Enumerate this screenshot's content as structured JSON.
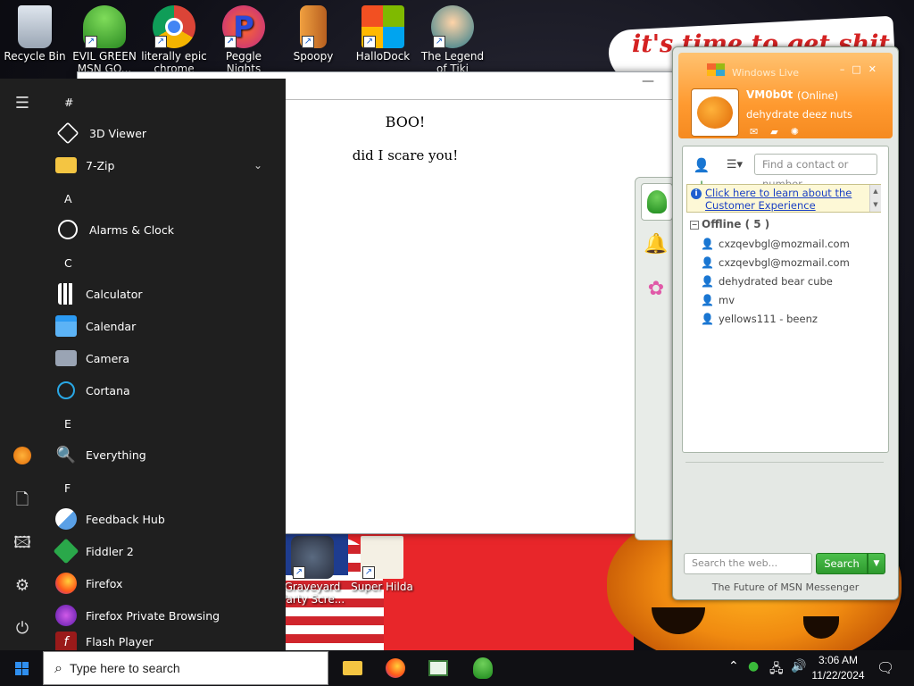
{
  "desktop": {
    "banner_text": "it's time to get shit",
    "icons": [
      {
        "label": "Recycle Bin"
      },
      {
        "label": "EVIL GREEN MSN GO..."
      },
      {
        "label": "literally epic chrome"
      },
      {
        "label": "Peggle Nights Deluxe"
      },
      {
        "label": "Spoopy"
      },
      {
        "label": "HalloDock"
      },
      {
        "label": "The Legend of Tiki"
      },
      {
        "label": "Graveyard Party Scre..."
      },
      {
        "label": "Super Hilda"
      }
    ]
  },
  "note_window": {
    "line1": "BOO!",
    "line2": "did I scare you!",
    "minimize_glyph": "—"
  },
  "start_menu": {
    "sections": [
      {
        "letter": "#"
      },
      {
        "letter": "A"
      },
      {
        "letter": "C"
      },
      {
        "letter": "E"
      },
      {
        "letter": "F"
      }
    ],
    "items": [
      {
        "label": "3D Viewer",
        "icon": "cube-icon"
      },
      {
        "label": "7-Zip",
        "icon": "folder-icon"
      },
      {
        "label": "Alarms & Clock",
        "icon": "clock-icon"
      },
      {
        "label": "Calculator",
        "icon": "calculator-icon"
      },
      {
        "label": "Calendar",
        "icon": "calendar-icon"
      },
      {
        "label": "Camera",
        "icon": "camera-icon"
      },
      {
        "label": "Cortana",
        "icon": "cortana-icon"
      },
      {
        "label": "Everything",
        "icon": "magnifier-icon"
      },
      {
        "label": "Feedback Hub",
        "icon": "feedback-icon"
      },
      {
        "label": "Fiddler 2",
        "icon": "fiddler-icon"
      },
      {
        "label": "Firefox",
        "icon": "firefox-icon"
      },
      {
        "label": "Firefox Private Browsing",
        "icon": "private-browsing-icon"
      },
      {
        "label": "Flash Player",
        "icon": "flash-icon"
      }
    ]
  },
  "messenger": {
    "app_title": "Windows Live",
    "display_name": "VM0b0t",
    "status": "(Online)",
    "personal_message": "dehydrate deez nuts",
    "find_placeholder": "Find a contact or number...",
    "info_link": "Click here to learn about the Customer Experience",
    "group_label": "Offline ( 5 )",
    "contacts": [
      {
        "name": "cxzqevbgl@mozmail.com"
      },
      {
        "name": "cxzqevbgl@mozmail.com"
      },
      {
        "name": "dehydrated bear cube"
      },
      {
        "name": "mv"
      },
      {
        "name": "yellows111 - beenz"
      }
    ],
    "web_search_placeholder": "Search the web...",
    "search_button": "Search",
    "footer": "The Future of MSN Messenger"
  },
  "taskbar": {
    "search_placeholder": "Type here to search",
    "time": "3:06 AM",
    "date": "11/22/2024"
  },
  "colors": {
    "msn_orange": "#ff9a30",
    "start_menu_bg": "#1f1f1f",
    "taskbar_bg": "#101014",
    "link_blue": "#1a3fc4",
    "search_green": "#2e9a2e"
  }
}
